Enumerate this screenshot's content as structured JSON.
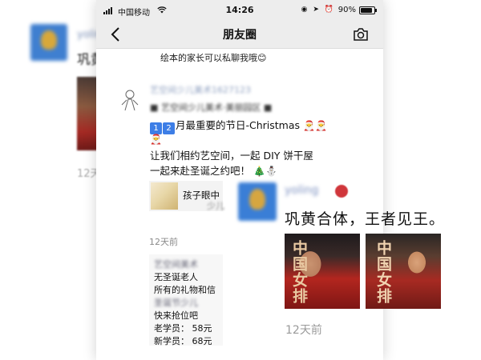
{
  "status_bar": {
    "carrier": "中国移动",
    "time": "14:26",
    "battery": "90%"
  },
  "nav": {
    "title": "朋友圈"
  },
  "background_moment": {
    "name_blurred": "yoling",
    "text": "巩黄",
    "time": "12天"
  },
  "previous_post": {
    "caption": "绘本的家长可以私聊我哦😊"
  },
  "post": {
    "name_blurred": "艺空间少儿美术1627123",
    "line1_blurred": "■ 艺空间少儿美术·美丽园区 ■",
    "line2_nums": [
      "1",
      "2"
    ],
    "line2_text": "月最重要的节日-Christmas",
    "line3": "让我们相约艺空间，一起 DIY 饼干屋",
    "line4": "一起来赴圣诞之约吧！",
    "link_text": "孩子眼中",
    "time": "12天前",
    "time_suffix_blur": "少儿",
    "comment": {
      "author_blurred": "艺空间美术",
      "line1": "无圣诞老人",
      "line2": "所有的礼物和信",
      "line3_blurred": "圣诞节少儿",
      "line4": "快来抢位吧",
      "line5": "老学员：  58元",
      "line6": "新学员：  68元"
    }
  },
  "foreground_moment": {
    "name_blurred": "yoling",
    "text": "巩黄合体，王者见王。",
    "poster_title": "中国女排",
    "time": "12天前"
  }
}
